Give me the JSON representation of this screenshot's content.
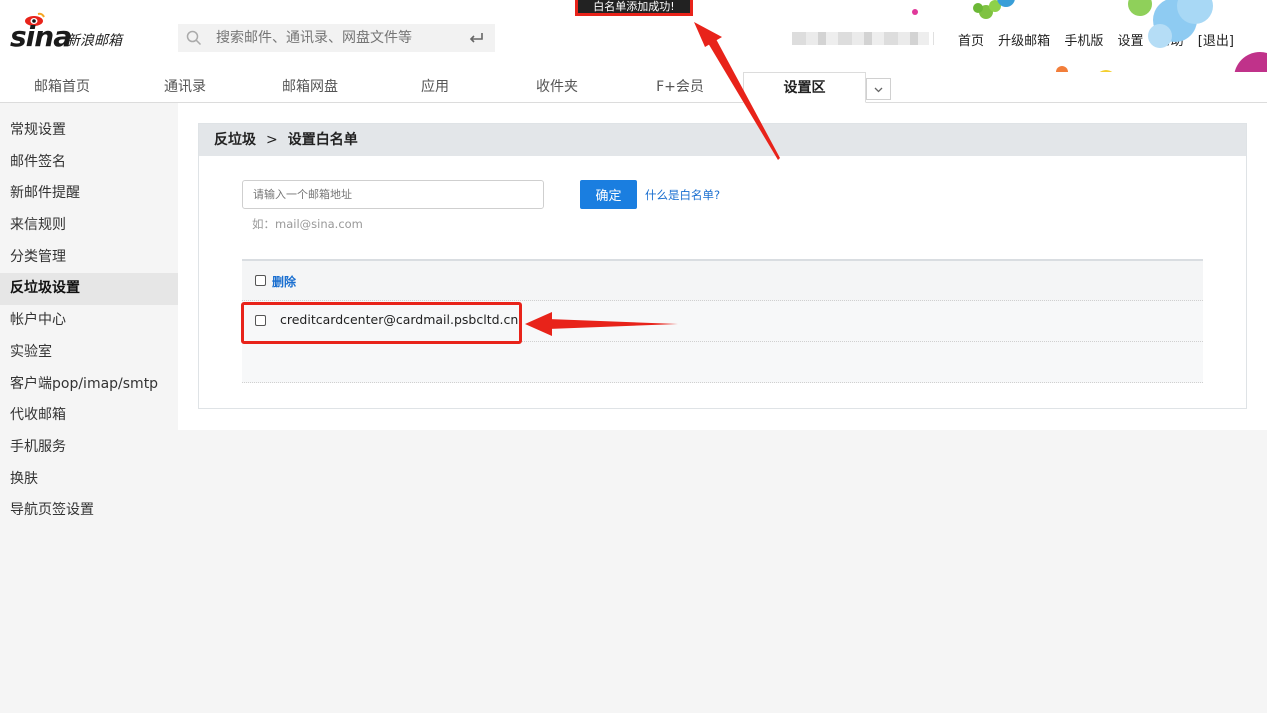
{
  "header": {
    "logo_text": "sina",
    "brand_label": "新浪邮箱",
    "search_placeholder": "搜索邮件、通讯录、网盘文件等",
    "toast": "白名单添加成功!",
    "top_links": [
      "首页",
      "升级邮箱",
      "手机版",
      "设置",
      "帮助",
      "[退出]"
    ]
  },
  "nav": {
    "tabs": [
      "邮箱首页",
      "通讯录",
      "邮箱网盘",
      "应用",
      "收件夹",
      "F+会员",
      "设置区"
    ],
    "active_index": 6
  },
  "sidebar": {
    "items": [
      "常规设置",
      "邮件签名",
      "新邮件提醒",
      "来信规则",
      "分类管理",
      "反垃圾设置",
      "帐户中心",
      "实验室",
      "客户端pop/imap/smtp",
      "代收邮箱",
      "手机服务",
      "换肤",
      "导航页签设置"
    ],
    "active_index": 5
  },
  "main": {
    "breadcrumb_parent": "反垃圾",
    "breadcrumb_sep": ">",
    "breadcrumb_current": "设置白名单",
    "input_placeholder": "请输入一个邮箱地址",
    "confirm_label": "确定",
    "help_link": "什么是白名单?",
    "example_text": "如：mail@sina.com",
    "delete_label": "删除",
    "whitelist": [
      "creditcardcenter@cardmail.psbcltd.cn"
    ]
  },
  "colors": {
    "accent": "#1a7ee0",
    "annotation": "#e8231a"
  }
}
